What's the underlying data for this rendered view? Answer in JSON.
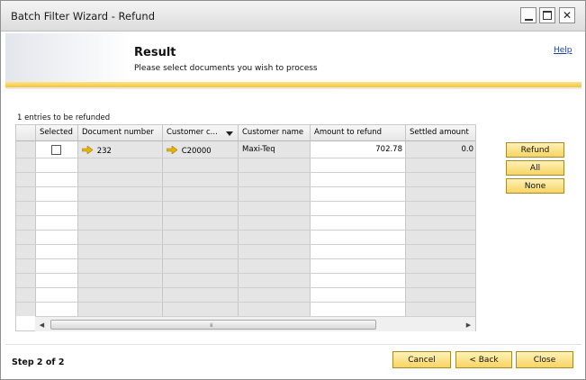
{
  "window": {
    "title": "Batch Filter Wizard - Refund"
  },
  "header": {
    "title": "Result",
    "subtitle": "Please select documents you wish to process",
    "help": "Help"
  },
  "entries_label": "1 entries to be refunded",
  "table": {
    "columns": [
      "Selected",
      "Document number",
      "Customer c...",
      "Customer name",
      "Amount to refund",
      "Settled amount"
    ],
    "rows": [
      {
        "selected": false,
        "document_number": "232",
        "customer_code": "C20000",
        "customer_name": "Maxi-Teq",
        "amount_to_refund": "702.78",
        "settled_amount": "0.0"
      }
    ]
  },
  "side_buttons": {
    "refund": "Refund",
    "all": "All",
    "none": "None"
  },
  "footer": {
    "step": "Step 2 of 2",
    "cancel": "Cancel",
    "back": "< Back",
    "close": "Close"
  },
  "colors": {
    "button_top": "#fff1b8",
    "button_bottom": "#f7d562",
    "stripe": "#f3c43a",
    "link_arrow": "#e8b400"
  }
}
